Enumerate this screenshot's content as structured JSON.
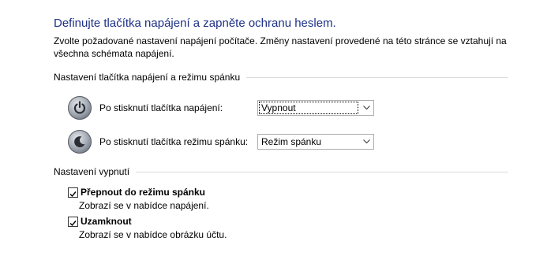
{
  "page": {
    "title": "Definujte tlačítka napájení a zapněte ochranu heslem.",
    "description": "Zvolte požadované nastavení napájení počítače. Změny nastavení provedené na této stránce se vztahují na všechna schémata napájení."
  },
  "buttons_group": {
    "header": "Nastavení tlačítka napájení a režimu spánku",
    "power": {
      "label": "Po stisknutí tlačítka napájení:",
      "value": "Vypnout",
      "icon": "power-icon"
    },
    "sleep": {
      "label": "Po stisknutí tlačítka režimu spánku:",
      "value": "Režim spánku",
      "icon": "sleep-icon"
    }
  },
  "shutdown_group": {
    "header": "Nastavení vypnutí",
    "items": [
      {
        "label": "Přepnout do režimu spánku",
        "description": "Zobrazí se v nabídce napájení.",
        "checked": true
      },
      {
        "label": "Uzamknout",
        "description": "Zobrazí se v nabídce obrázku účtu.",
        "checked": true
      }
    ]
  },
  "colors": {
    "title": "#1e3287",
    "divider": "#dcdcdc"
  }
}
